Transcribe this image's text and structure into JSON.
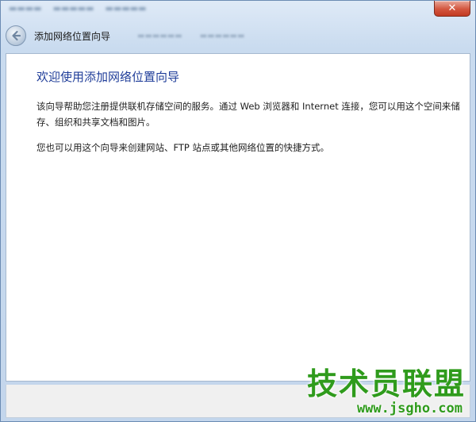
{
  "window": {
    "close_label": "✕"
  },
  "nav": {
    "wizard_title": "添加网络位置向导"
  },
  "content": {
    "heading": "欢迎使用添加网络位置向导",
    "paragraph1": "该向导帮助您注册提供联机存储空间的服务。通过 Web 浏览器和 Internet 连接，您可以用这个空间来储存、组织和共享文档和图片。",
    "paragraph2": "您也可以用这个向导来创建网站、FTP 站点或其他网络位置的快捷方式。"
  },
  "watermark": {
    "logo_text": "技术员联盟",
    "url_text": "www.jsgho.com"
  },
  "colors": {
    "heading": "#1f3d99",
    "close_button": "#c23a22",
    "watermark_green": "#2f9b1c"
  }
}
